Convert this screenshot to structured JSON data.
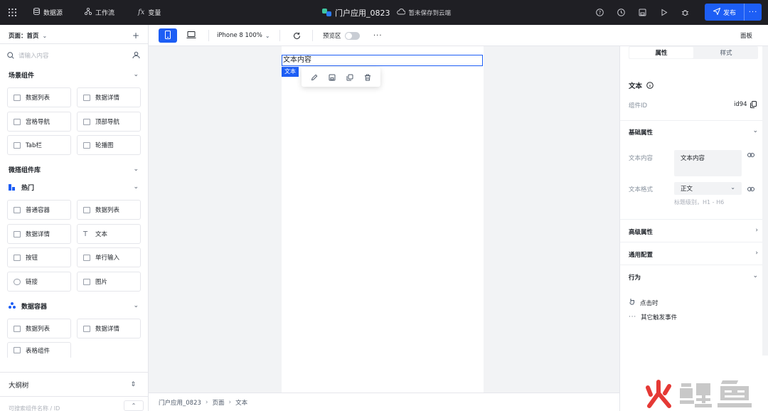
{
  "topbar": {
    "nav": [
      {
        "label": "数据源",
        "icon": "database-icon"
      },
      {
        "label": "工作流",
        "icon": "workflow-icon"
      },
      {
        "label": "变量",
        "icon": "variable-fx-icon"
      }
    ],
    "app_title": "门户应用_0823",
    "save_status": "暂未保存到云端",
    "publish_label": "发布",
    "publish_more": "···"
  },
  "left": {
    "page_selector": "页面：首页",
    "search_placeholder": "请输入内容",
    "scene_section": "场景组件",
    "scene_items": [
      "数据列表",
      "数据详情",
      "宫格导航",
      "顶部导航",
      "Tab栏",
      "轮播图"
    ],
    "lib_section": "微搭组件库",
    "hot_section": "热门",
    "hot_items": [
      "普通容器",
      "数据列表",
      "数据详情",
      "文本",
      "按钮",
      "单行输入",
      "链接",
      "图片"
    ],
    "data_section": "数据容器",
    "data_items": [
      "数据列表",
      "数据详情",
      "表格组件"
    ],
    "outline_title": "大纲树",
    "outline_placeholder": "可搜索组件名称 / ID"
  },
  "toolbar": {
    "device_preset": "iPhone 8 100%",
    "preview_label": "预览区",
    "more": "···",
    "panel_label": "面板"
  },
  "canvas": {
    "selected_text": "文本内容",
    "selected_tag": "文本"
  },
  "breadcrumb": [
    "门户应用_0823",
    "页面",
    "文本"
  ],
  "right": {
    "tabs": [
      "属性",
      "样式"
    ],
    "component_name": "文本",
    "component_id_label": "组件ID",
    "component_id": "id94",
    "basic_section": "基础属性",
    "text_content_label": "文本内容",
    "text_content_value": "文本内容",
    "text_format_label": "文本格式",
    "text_format_value": "正文",
    "text_format_hint": "标题级别，H1 - H6",
    "advanced_section": "高级属性",
    "general_section": "通用配置",
    "behavior_section": "行为",
    "on_click": "点击时",
    "other_events": "其它触发事件"
  },
  "colors": {
    "accent": "#1d5ef5",
    "topbar_bg": "#1f1f24",
    "watermark_red": "#e53935",
    "watermark_gray": "#c8c8c8"
  }
}
